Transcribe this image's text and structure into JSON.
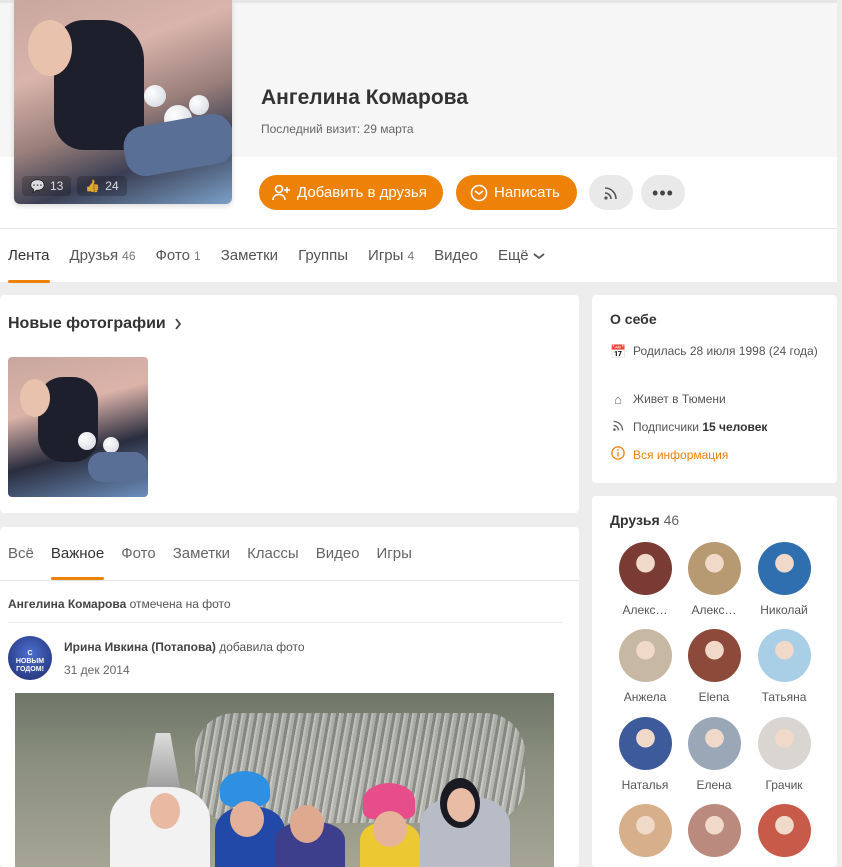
{
  "profile": {
    "name": "Ангелина Комарова",
    "last_visit": "Последний визит: 29 марта",
    "avatar_comments": "13",
    "avatar_likes": "24"
  },
  "actions": {
    "add_friend": "Добавить в друзья",
    "message": "Написать"
  },
  "nav": [
    {
      "label": "Лента",
      "count": ""
    },
    {
      "label": "Друзья",
      "count": "46"
    },
    {
      "label": "Фото",
      "count": "1"
    },
    {
      "label": "Заметки",
      "count": ""
    },
    {
      "label": "Группы",
      "count": ""
    },
    {
      "label": "Игры",
      "count": "4"
    },
    {
      "label": "Видео",
      "count": ""
    },
    {
      "label": "Ещё",
      "count": ""
    }
  ],
  "photos": {
    "title": "Новые фотографии"
  },
  "feed": {
    "tabs": [
      "Всё",
      "Важное",
      "Фото",
      "Заметки",
      "Классы",
      "Видео",
      "Игры"
    ],
    "note_name": "Ангелина Комарова",
    "note_text": " отмечена на фото",
    "post_author": "Ирина Ивкина (Потапова)",
    "post_action": " добавила фото",
    "post_date": "31 дек 2014",
    "post_avatar_text": "С НОВЫМ ГОДОМ!"
  },
  "about": {
    "title": "О себе",
    "birthday": "Родилась 28 июля 1998 (24 года)",
    "city": "Живет в Тюмени",
    "subscribers_label": "Подписчики ",
    "subscribers_value": "15 человек",
    "all_info": "Вся информация"
  },
  "friends": {
    "title": "Друзья",
    "count": "46",
    "list": [
      {
        "name": "Алекс…",
        "color": "#7a3b34"
      },
      {
        "name": "Алекс…",
        "color": "#b79a72"
      },
      {
        "name": "Николай",
        "color": "#2f6fb0"
      },
      {
        "name": "Анжела",
        "color": "#c7b8a4"
      },
      {
        "name": "Elena",
        "color": "#8d4a3a"
      },
      {
        "name": "Татьяна",
        "color": "#a9cfe6"
      },
      {
        "name": "Наталья",
        "color": "#3d5a9a"
      },
      {
        "name": "Елена",
        "color": "#9aa7b6"
      },
      {
        "name": "Грачик",
        "color": "#d9d5d0"
      },
      {
        "name": "",
        "color": "#d7b08b"
      },
      {
        "name": "",
        "color": "#b98a7d"
      },
      {
        "name": "",
        "color": "#c85a4a"
      }
    ]
  }
}
